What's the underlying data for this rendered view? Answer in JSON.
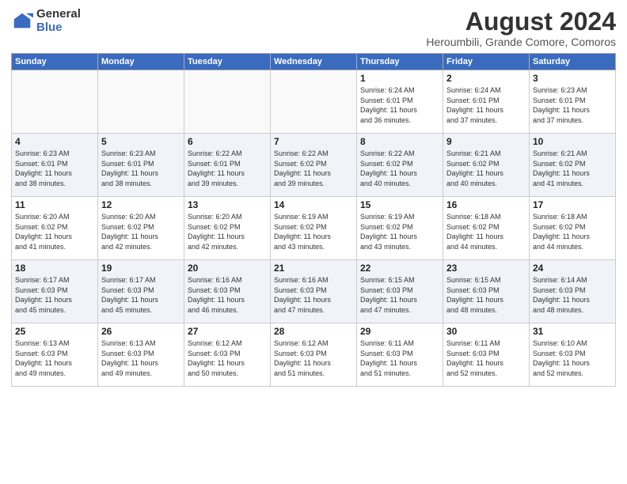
{
  "logo": {
    "general": "General",
    "blue": "Blue"
  },
  "header": {
    "month_year": "August 2024",
    "location": "Heroumbili, Grande Comore, Comoros"
  },
  "weekdays": [
    "Sunday",
    "Monday",
    "Tuesday",
    "Wednesday",
    "Thursday",
    "Friday",
    "Saturday"
  ],
  "weeks": [
    [
      {
        "day": "",
        "info": ""
      },
      {
        "day": "",
        "info": ""
      },
      {
        "day": "",
        "info": ""
      },
      {
        "day": "",
        "info": ""
      },
      {
        "day": "1",
        "info": "Sunrise: 6:24 AM\nSunset: 6:01 PM\nDaylight: 11 hours\nand 36 minutes."
      },
      {
        "day": "2",
        "info": "Sunrise: 6:24 AM\nSunset: 6:01 PM\nDaylight: 11 hours\nand 37 minutes."
      },
      {
        "day": "3",
        "info": "Sunrise: 6:23 AM\nSunset: 6:01 PM\nDaylight: 11 hours\nand 37 minutes."
      }
    ],
    [
      {
        "day": "4",
        "info": "Sunrise: 6:23 AM\nSunset: 6:01 PM\nDaylight: 11 hours\nand 38 minutes."
      },
      {
        "day": "5",
        "info": "Sunrise: 6:23 AM\nSunset: 6:01 PM\nDaylight: 11 hours\nand 38 minutes."
      },
      {
        "day": "6",
        "info": "Sunrise: 6:22 AM\nSunset: 6:01 PM\nDaylight: 11 hours\nand 39 minutes."
      },
      {
        "day": "7",
        "info": "Sunrise: 6:22 AM\nSunset: 6:02 PM\nDaylight: 11 hours\nand 39 minutes."
      },
      {
        "day": "8",
        "info": "Sunrise: 6:22 AM\nSunset: 6:02 PM\nDaylight: 11 hours\nand 40 minutes."
      },
      {
        "day": "9",
        "info": "Sunrise: 6:21 AM\nSunset: 6:02 PM\nDaylight: 11 hours\nand 40 minutes."
      },
      {
        "day": "10",
        "info": "Sunrise: 6:21 AM\nSunset: 6:02 PM\nDaylight: 11 hours\nand 41 minutes."
      }
    ],
    [
      {
        "day": "11",
        "info": "Sunrise: 6:20 AM\nSunset: 6:02 PM\nDaylight: 11 hours\nand 41 minutes."
      },
      {
        "day": "12",
        "info": "Sunrise: 6:20 AM\nSunset: 6:02 PM\nDaylight: 11 hours\nand 42 minutes."
      },
      {
        "day": "13",
        "info": "Sunrise: 6:20 AM\nSunset: 6:02 PM\nDaylight: 11 hours\nand 42 minutes."
      },
      {
        "day": "14",
        "info": "Sunrise: 6:19 AM\nSunset: 6:02 PM\nDaylight: 11 hours\nand 43 minutes."
      },
      {
        "day": "15",
        "info": "Sunrise: 6:19 AM\nSunset: 6:02 PM\nDaylight: 11 hours\nand 43 minutes."
      },
      {
        "day": "16",
        "info": "Sunrise: 6:18 AM\nSunset: 6:02 PM\nDaylight: 11 hours\nand 44 minutes."
      },
      {
        "day": "17",
        "info": "Sunrise: 6:18 AM\nSunset: 6:02 PM\nDaylight: 11 hours\nand 44 minutes."
      }
    ],
    [
      {
        "day": "18",
        "info": "Sunrise: 6:17 AM\nSunset: 6:03 PM\nDaylight: 11 hours\nand 45 minutes."
      },
      {
        "day": "19",
        "info": "Sunrise: 6:17 AM\nSunset: 6:03 PM\nDaylight: 11 hours\nand 45 minutes."
      },
      {
        "day": "20",
        "info": "Sunrise: 6:16 AM\nSunset: 6:03 PM\nDaylight: 11 hours\nand 46 minutes."
      },
      {
        "day": "21",
        "info": "Sunrise: 6:16 AM\nSunset: 6:03 PM\nDaylight: 11 hours\nand 47 minutes."
      },
      {
        "day": "22",
        "info": "Sunrise: 6:15 AM\nSunset: 6:03 PM\nDaylight: 11 hours\nand 47 minutes."
      },
      {
        "day": "23",
        "info": "Sunrise: 6:15 AM\nSunset: 6:03 PM\nDaylight: 11 hours\nand 48 minutes."
      },
      {
        "day": "24",
        "info": "Sunrise: 6:14 AM\nSunset: 6:03 PM\nDaylight: 11 hours\nand 48 minutes."
      }
    ],
    [
      {
        "day": "25",
        "info": "Sunrise: 6:13 AM\nSunset: 6:03 PM\nDaylight: 11 hours\nand 49 minutes."
      },
      {
        "day": "26",
        "info": "Sunrise: 6:13 AM\nSunset: 6:03 PM\nDaylight: 11 hours\nand 49 minutes."
      },
      {
        "day": "27",
        "info": "Sunrise: 6:12 AM\nSunset: 6:03 PM\nDaylight: 11 hours\nand 50 minutes."
      },
      {
        "day": "28",
        "info": "Sunrise: 6:12 AM\nSunset: 6:03 PM\nDaylight: 11 hours\nand 51 minutes."
      },
      {
        "day": "29",
        "info": "Sunrise: 6:11 AM\nSunset: 6:03 PM\nDaylight: 11 hours\nand 51 minutes."
      },
      {
        "day": "30",
        "info": "Sunrise: 6:11 AM\nSunset: 6:03 PM\nDaylight: 11 hours\nand 52 minutes."
      },
      {
        "day": "31",
        "info": "Sunrise: 6:10 AM\nSunset: 6:03 PM\nDaylight: 11 hours\nand 52 minutes."
      }
    ]
  ]
}
